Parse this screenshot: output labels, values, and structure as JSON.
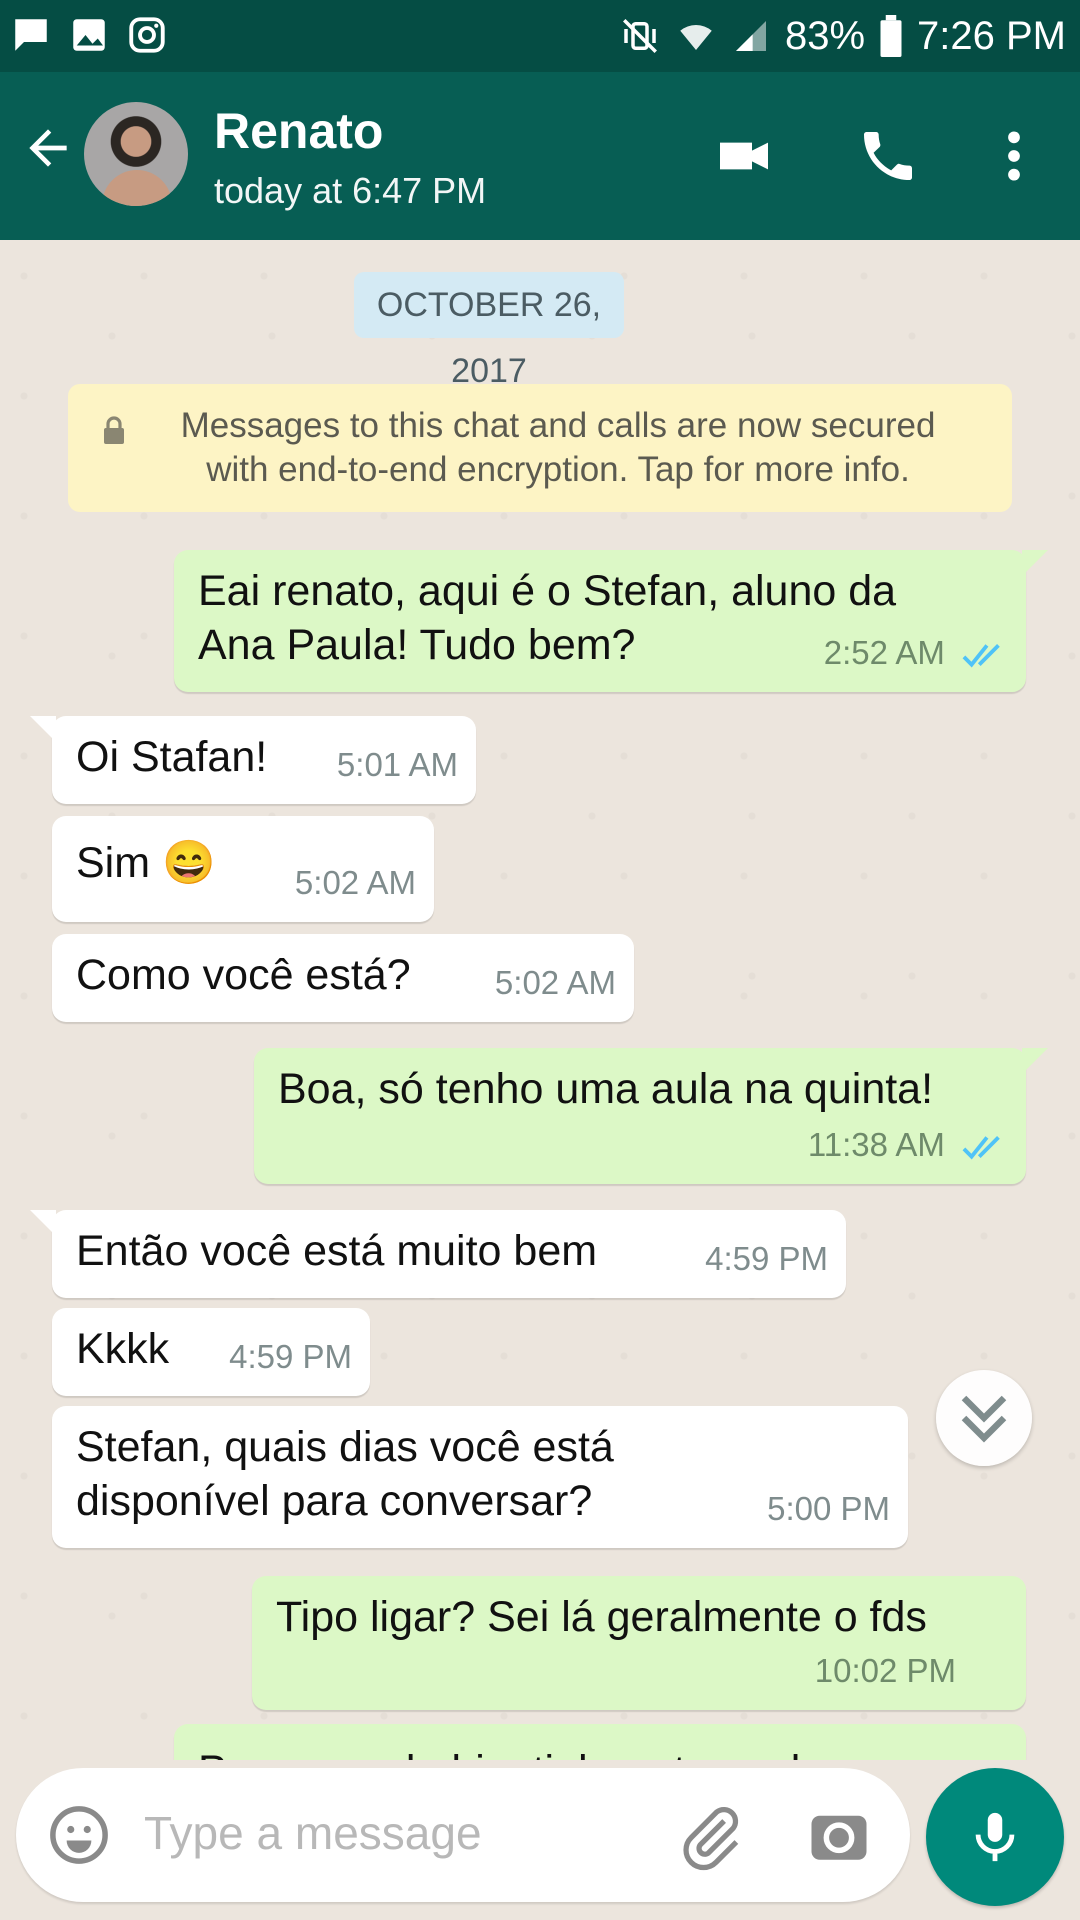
{
  "status_bar": {
    "battery": "83%",
    "time": "7:26 PM",
    "icons": [
      "message-icon",
      "gallery-icon",
      "instagram-icon",
      "mute-vibrate-icon",
      "wifi-icon",
      "signal-icon",
      "battery-icon"
    ]
  },
  "header": {
    "contact_name": "Renato",
    "last_seen": "today at 6:47 PM",
    "icons": [
      "back-arrow-icon",
      "video-call-icon",
      "voice-call-icon",
      "more-options-icon"
    ]
  },
  "chat": {
    "date_chip": "OCTOBER 26, 2017",
    "encryption_notice_line1": "Messages to this chat and calls are now secured",
    "encryption_notice_line2": "with end-to-end encryption. Tap for more info.",
    "messages": [
      {
        "direction": "out",
        "text_line1": "Eai renato, aqui é o Stefan, aluno da",
        "text_line2": "Ana Paula! Tudo bem?",
        "time": "2:52 AM"
      },
      {
        "direction": "in",
        "text": "Oi Stafan!",
        "time": "5:01 AM"
      },
      {
        "direction": "in",
        "text": "Sim 😄",
        "time": "5:02 AM"
      },
      {
        "direction": "in",
        "text": "Como você está?",
        "time": "5:02 AM"
      },
      {
        "direction": "out",
        "text": "Boa, só tenho uma aula na quinta!",
        "time": "11:38 AM"
      },
      {
        "direction": "in",
        "text": "Então você está muito bem",
        "time": "4:59 PM"
      },
      {
        "direction": "in",
        "text": "Kkkk",
        "time": "4:59 PM"
      },
      {
        "direction": "in",
        "text_line1": "Stefan, quais dias você está",
        "text_line2": "disponível para conversar?",
        "time": "5:00 PM"
      },
      {
        "direction": "out",
        "text": "Tipo ligar? Sei lá geralmente o fds",
        "time": "10:02 PM"
      },
      {
        "direction": "out",
        "text": "Por exemplo hj n tinha mtas aulas",
        "time": ""
      }
    ]
  },
  "composer": {
    "placeholder": "Type a message",
    "icons": [
      "emoji-icon",
      "attachment-icon",
      "camera-icon",
      "microphone-icon"
    ]
  },
  "colors": {
    "status_bar": "#054d44",
    "app_bar": "#075e54",
    "outgoing_bubble": "#dcf8c6",
    "incoming_bubble": "#ffffff",
    "read_ticks": "#4fc3f7",
    "mic_button": "#00897b"
  }
}
